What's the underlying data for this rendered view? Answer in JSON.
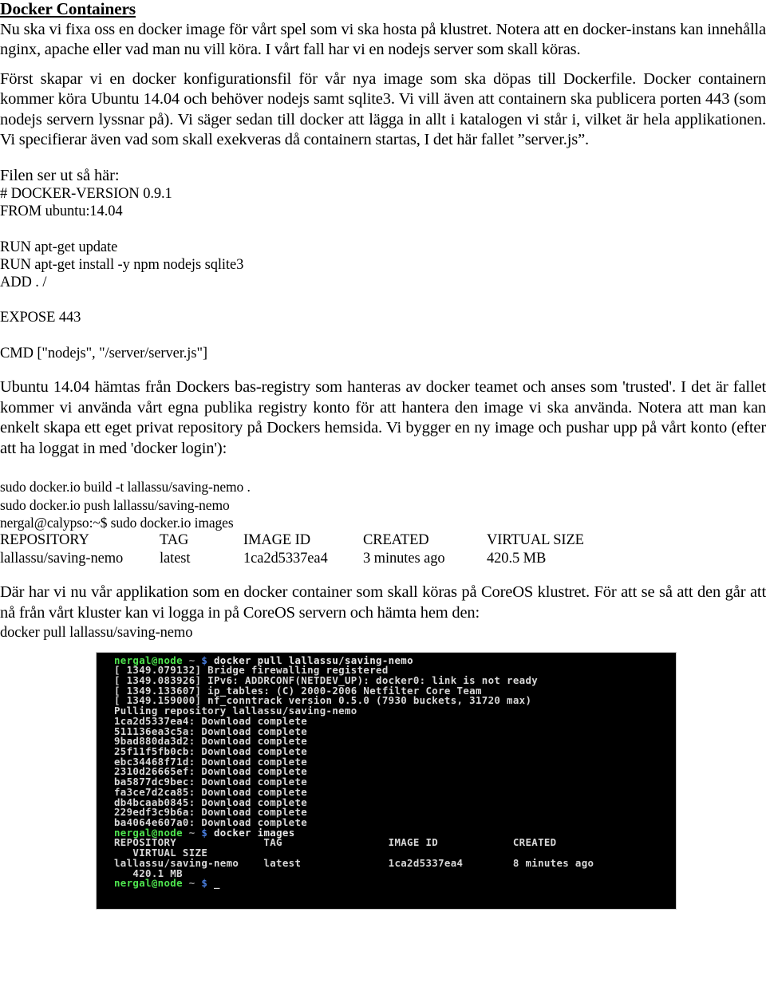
{
  "document": {
    "title": "Docker Containers",
    "paragraphs": {
      "intro": "Nu ska vi fixa oss en docker image för vårt spel som vi ska hosta på klustret. Notera att en docker-instans kan innehålla nginx, apache eller vad man nu vill köra. I vårt fall har vi en nodejs server som skall köras.",
      "dockerfile_intro": "Först skapar vi en docker konfigurationsfil för vår nya image som ska döpas till Dockerfile. Docker containern kommer köra Ubuntu 14.04 och behöver nodejs samt sqlite3. Vi vill även att containern ska publicera porten 443 (som nodejs servern lyssnar på).  Vi säger sedan till docker att lägga in allt i katalogen vi står i, vilket är hela applikationen. Vi specifierar även vad som skall exekveras då containern startas, I det här fallet ”server.js”.",
      "registry": "Ubuntu 14.04 hämtas från Dockers bas-registry som hanteras av docker teamet och anses som 'trusted'. I det är fallet kommer vi använda vårt egna publika registry konto för att hantera den image vi ska använda. Notera att man kan enkelt skapa ett eget privat repository på Dockers hemsida. Vi bygger en ny image och pushar upp på vårt konto (efter att ha loggat in med 'docker login'):",
      "coreos": "Där har vi nu vår applikation som en docker container som skall köras på CoreOS klustret. För att se så att den går att nå från vårt kluster kan vi logga in på CoreOS servern och hämta hem den:"
    },
    "file_intro_label": "Filen ser ut så här:",
    "dockerfile_lines": [
      "# DOCKER-VERSION 0.9.1",
      "FROM ubuntu:14.04",
      "",
      "RUN apt-get update",
      "RUN apt-get install -y npm nodejs sqlite3",
      "ADD . /",
      "",
      "EXPOSE 443",
      "",
      "CMD [\"nodejs\", \"/server/server.js\"]"
    ],
    "build_commands": [
      "sudo docker.io build -t lallassu/saving-nemo .",
      "sudo docker.io push lallassu/saving-nemo",
      "nergal@calypso:~$ sudo docker.io images"
    ],
    "images_table": {
      "headers": [
        "REPOSITORY",
        "TAG",
        "IMAGE ID",
        "CREATED",
        "VIRTUAL SIZE"
      ],
      "rows": [
        [
          "lallassu/saving-nemo",
          "latest",
          "1ca2d5337ea4",
          "3 minutes ago",
          "420.5 MB"
        ]
      ]
    },
    "pull_command": "docker pull lallassu/saving-nemo"
  },
  "terminal": {
    "prompt": {
      "user": "nergal@node",
      "tilde": "~",
      "dollar": "$"
    },
    "colors": {
      "background": "#000000",
      "user": "#4ee44e",
      "dollar": "#4a7fe0",
      "text": "#d8d8d8"
    },
    "lines": [
      {
        "type": "prompt",
        "command": "docker pull lallassu/saving-nemo"
      },
      {
        "type": "out",
        "text": "[ 1349.079132] Bridge firewalling registered"
      },
      {
        "type": "out",
        "text": "[ 1349.083926] IPv6: ADDRCONF(NETDEV_UP): docker0: link is not ready"
      },
      {
        "type": "out",
        "text": "[ 1349.133607] ip_tables: (C) 2000-2006 Netfilter Core Team"
      },
      {
        "type": "out",
        "text": "[ 1349.159000] nf_conntrack version 0.5.0 (7930 buckets, 31720 max)"
      },
      {
        "type": "out",
        "text": "Pulling repository lallassu/saving-nemo"
      },
      {
        "type": "out",
        "text": "1ca2d5337ea4: Download complete"
      },
      {
        "type": "out",
        "text": "511136ea3c5a: Download complete"
      },
      {
        "type": "out",
        "text": "9bad880da3d2: Download complete"
      },
      {
        "type": "out",
        "text": "25f11f5fb0cb: Download complete"
      },
      {
        "type": "out",
        "text": "ebc34468f71d: Download complete"
      },
      {
        "type": "out",
        "text": "2310d26665ef: Download complete"
      },
      {
        "type": "out",
        "text": "ba5877dc9bec: Download complete"
      },
      {
        "type": "out",
        "text": "fa3ce7d2ca85: Download complete"
      },
      {
        "type": "out",
        "text": "db4bcaab0845: Download complete"
      },
      {
        "type": "out",
        "text": "229edf3c9b6a: Download complete"
      },
      {
        "type": "out",
        "text": "ba4064e607a0: Download complete"
      },
      {
        "type": "prompt",
        "command": "docker images"
      },
      {
        "type": "out",
        "text": "REPOSITORY              TAG                 IMAGE ID            CREATED"
      },
      {
        "type": "out",
        "text": "   VIRTUAL SIZE"
      },
      {
        "type": "out",
        "text": "lallassu/saving-nemo    latest              1ca2d5337ea4        8 minutes ago"
      },
      {
        "type": "out",
        "text": "   420.1 MB"
      },
      {
        "type": "cursor",
        "text": "_"
      }
    ]
  }
}
